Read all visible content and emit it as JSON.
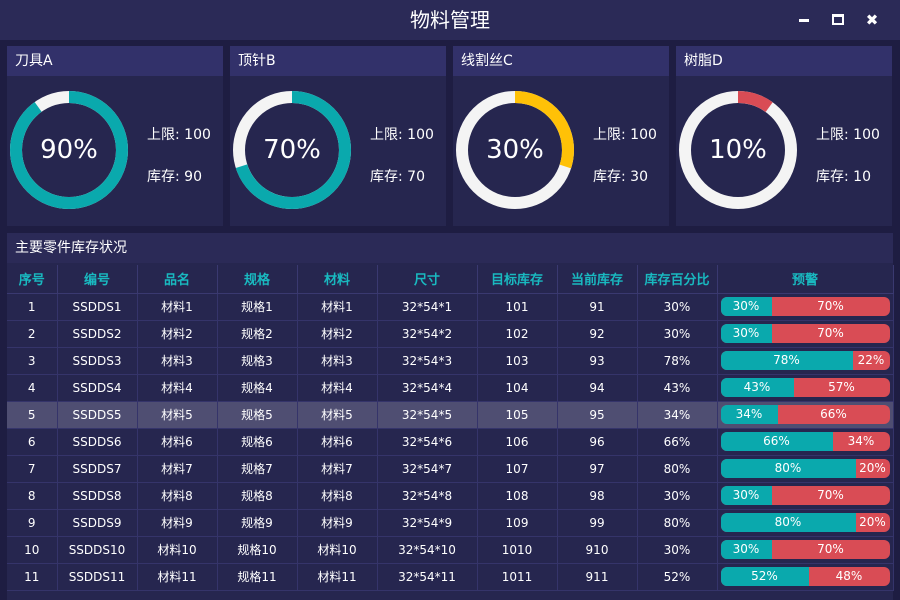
{
  "window": {
    "title": "物料管理"
  },
  "colors": {
    "teal": "#0aa9ad",
    "yellow": "#ffc107",
    "red": "#d94c55",
    "track": "#f4f4f4"
  },
  "cards": [
    {
      "name": "刀具A",
      "percent_label": "90%",
      "percent": 0.9,
      "limit_label": "上限: 100",
      "stock_label": "库存: 90",
      "color": "#0aa9ad"
    },
    {
      "name": "顶针B",
      "percent_label": "70%",
      "percent": 0.7,
      "limit_label": "上限: 100",
      "stock_label": "库存: 70",
      "color": "#0aa9ad"
    },
    {
      "name": "线割丝C",
      "percent_label": "30%",
      "percent": 0.3,
      "limit_label": "上限: 100",
      "stock_label": "库存: 30",
      "color": "#ffc107"
    },
    {
      "name": "树脂D",
      "percent_label": "10%",
      "percent": 0.1,
      "limit_label": "上限: 100",
      "stock_label": "库存: 10",
      "color": "#d94c55"
    }
  ],
  "table": {
    "title": "主要零件库存状况",
    "columns": [
      "序号",
      "编号",
      "品名",
      "规格",
      "材料",
      "尺寸",
      "目标库存",
      "当前库存",
      "库存百分比",
      "预警"
    ],
    "rows": [
      {
        "no": "1",
        "code": "SSDDS1",
        "name": "材料1",
        "spec": "规格1",
        "material": "材料1",
        "size": "32*54*1",
        "target": "101",
        "current": "91",
        "pct": "30%",
        "warn_a": "30%",
        "warn_b": "70%",
        "ratio": 0.3
      },
      {
        "no": "2",
        "code": "SSDDS2",
        "name": "材料2",
        "spec": "规格2",
        "material": "材料2",
        "size": "32*54*2",
        "target": "102",
        "current": "92",
        "pct": "30%",
        "warn_a": "30%",
        "warn_b": "70%",
        "ratio": 0.3
      },
      {
        "no": "3",
        "code": "SSDDS3",
        "name": "材料3",
        "spec": "规格3",
        "material": "材料3",
        "size": "32*54*3",
        "target": "103",
        "current": "93",
        "pct": "78%",
        "warn_a": "78%",
        "warn_b": "22%",
        "ratio": 0.78
      },
      {
        "no": "4",
        "code": "SSDDS4",
        "name": "材料4",
        "spec": "规格4",
        "material": "材料4",
        "size": "32*54*4",
        "target": "104",
        "current": "94",
        "pct": "43%",
        "warn_a": "43%",
        "warn_b": "57%",
        "ratio": 0.43
      },
      {
        "no": "5",
        "code": "SSDDS5",
        "name": "材料5",
        "spec": "规格5",
        "material": "材料5",
        "size": "32*54*5",
        "target": "105",
        "current": "95",
        "pct": "34%",
        "warn_a": "34%",
        "warn_b": "66%",
        "ratio": 0.34,
        "selected": true
      },
      {
        "no": "6",
        "code": "SSDDS6",
        "name": "材料6",
        "spec": "规格6",
        "material": "材料6",
        "size": "32*54*6",
        "target": "106",
        "current": "96",
        "pct": "66%",
        "warn_a": "66%",
        "warn_b": "34%",
        "ratio": 0.66
      },
      {
        "no": "7",
        "code": "SSDDS7",
        "name": "材料7",
        "spec": "规格7",
        "material": "材料7",
        "size": "32*54*7",
        "target": "107",
        "current": "97",
        "pct": "80%",
        "warn_a": "80%",
        "warn_b": "20%",
        "ratio": 0.8
      },
      {
        "no": "8",
        "code": "SSDDS8",
        "name": "材料8",
        "spec": "规格8",
        "material": "材料8",
        "size": "32*54*8",
        "target": "108",
        "current": "98",
        "pct": "30%",
        "warn_a": "30%",
        "warn_b": "70%",
        "ratio": 0.3
      },
      {
        "no": "9",
        "code": "SSDDS9",
        "name": "材料9",
        "spec": "规格9",
        "material": "材料9",
        "size": "32*54*9",
        "target": "109",
        "current": "99",
        "pct": "80%",
        "warn_a": "80%",
        "warn_b": "20%",
        "ratio": 0.8
      },
      {
        "no": "10",
        "code": "SSDDS10",
        "name": "材料10",
        "spec": "规格10",
        "material": "材料10",
        "size": "32*54*10",
        "target": "1010",
        "current": "910",
        "pct": "30%",
        "warn_a": "30%",
        "warn_b": "70%",
        "ratio": 0.3
      },
      {
        "no": "11",
        "code": "SSDDS11",
        "name": "材料11",
        "spec": "规格11",
        "material": "材料11",
        "size": "32*54*11",
        "target": "1011",
        "current": "911",
        "pct": "52%",
        "warn_a": "52%",
        "warn_b": "48%",
        "ratio": 0.52
      }
    ]
  }
}
